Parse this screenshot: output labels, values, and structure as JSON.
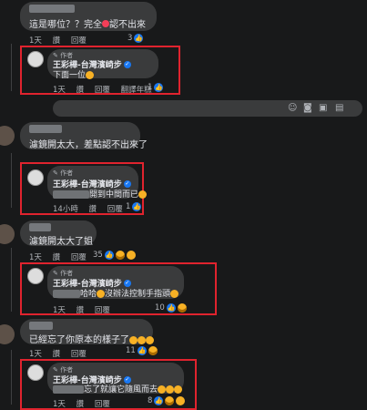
{
  "comment1": {
    "text": "這是哪位？？完全",
    "text_end": "認不出來",
    "time": "1天",
    "like": "讚",
    "reply": "回覆",
    "reactions": "3"
  },
  "reply1": {
    "author_tag": "作者",
    "author": "王彩樺-台灣濱崎步",
    "text": "下面一位",
    "time": "1天",
    "like": "讚",
    "reply": "回覆",
    "translate": "翻譯年糕",
    "reactions": "1"
  },
  "input_bar": {
    "icons": [
      "emoji-icon",
      "camera-icon",
      "gif-icon",
      "sticker-icon"
    ]
  },
  "comment2": {
    "text": "濾鏡開太大，差點認不出來了"
  },
  "reply2": {
    "author_tag": "作者",
    "author": "王彩樺-台灣濱崎步",
    "text": "開到中間而已",
    "time": "14小時",
    "like": "讚",
    "reply": "回覆",
    "reactions": "1"
  },
  "comment3": {
    "text": "濾鏡開太大了姐",
    "time": "1天",
    "like": "讚",
    "reply": "回覆",
    "reactions": "35"
  },
  "reply3": {
    "author_tag": "作者",
    "author": "王彩樺-台灣濱崎步",
    "text": "哈哈",
    "text2": "沒辦法控制手指頭",
    "time": "1天",
    "like": "讚",
    "reply": "回覆",
    "reactions": "10"
  },
  "comment4": {
    "text": "已經忘了你原本的樣子了",
    "time": "1天",
    "like": "讚",
    "reply": "回覆",
    "reactions": "11"
  },
  "reply4": {
    "author_tag": "作者",
    "author": "王彩樺-台灣濱崎步",
    "text": "忘了就讓它隨風而去",
    "time": "1天",
    "like": "讚",
    "reply": "回覆",
    "reactions": "8"
  }
}
